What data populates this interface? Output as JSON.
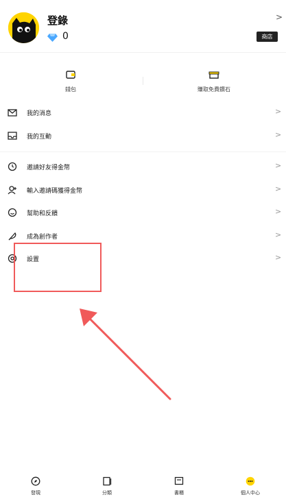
{
  "profile": {
    "username": "登錄",
    "gem_count": "0",
    "shop_label": "商店"
  },
  "quick_actions": [
    {
      "label": "錢包",
      "icon": "wallet-icon"
    },
    {
      "label": "賺取免費鑽石",
      "icon": "gift-box-icon"
    }
  ],
  "menu": {
    "group1": [
      {
        "label": "我的消息",
        "icon": "mail-icon"
      },
      {
        "label": "我的互動",
        "icon": "inbox-icon"
      }
    ],
    "group2": [
      {
        "label": "邀請好友得金幣",
        "icon": "coin-clock-icon"
      },
      {
        "label": "輸入邀請碼獲得金幣",
        "icon": "add-user-icon"
      },
      {
        "label": "幫助和反饋",
        "icon": "smile-icon"
      },
      {
        "label": "成為創作者",
        "icon": "feather-icon"
      },
      {
        "label": "設置",
        "icon": "settings-icon"
      }
    ]
  },
  "nav": [
    {
      "label": "發現",
      "icon": "compass-icon"
    },
    {
      "label": "分類",
      "icon": "category-icon"
    },
    {
      "label": "書櫃",
      "icon": "bookshelf-icon"
    },
    {
      "label": "個人中心",
      "icon": "profile-center-icon"
    }
  ],
  "colors": {
    "accent": "#ffd400",
    "annotation": "#f05a5a",
    "gem": "#4aa8ff"
  }
}
